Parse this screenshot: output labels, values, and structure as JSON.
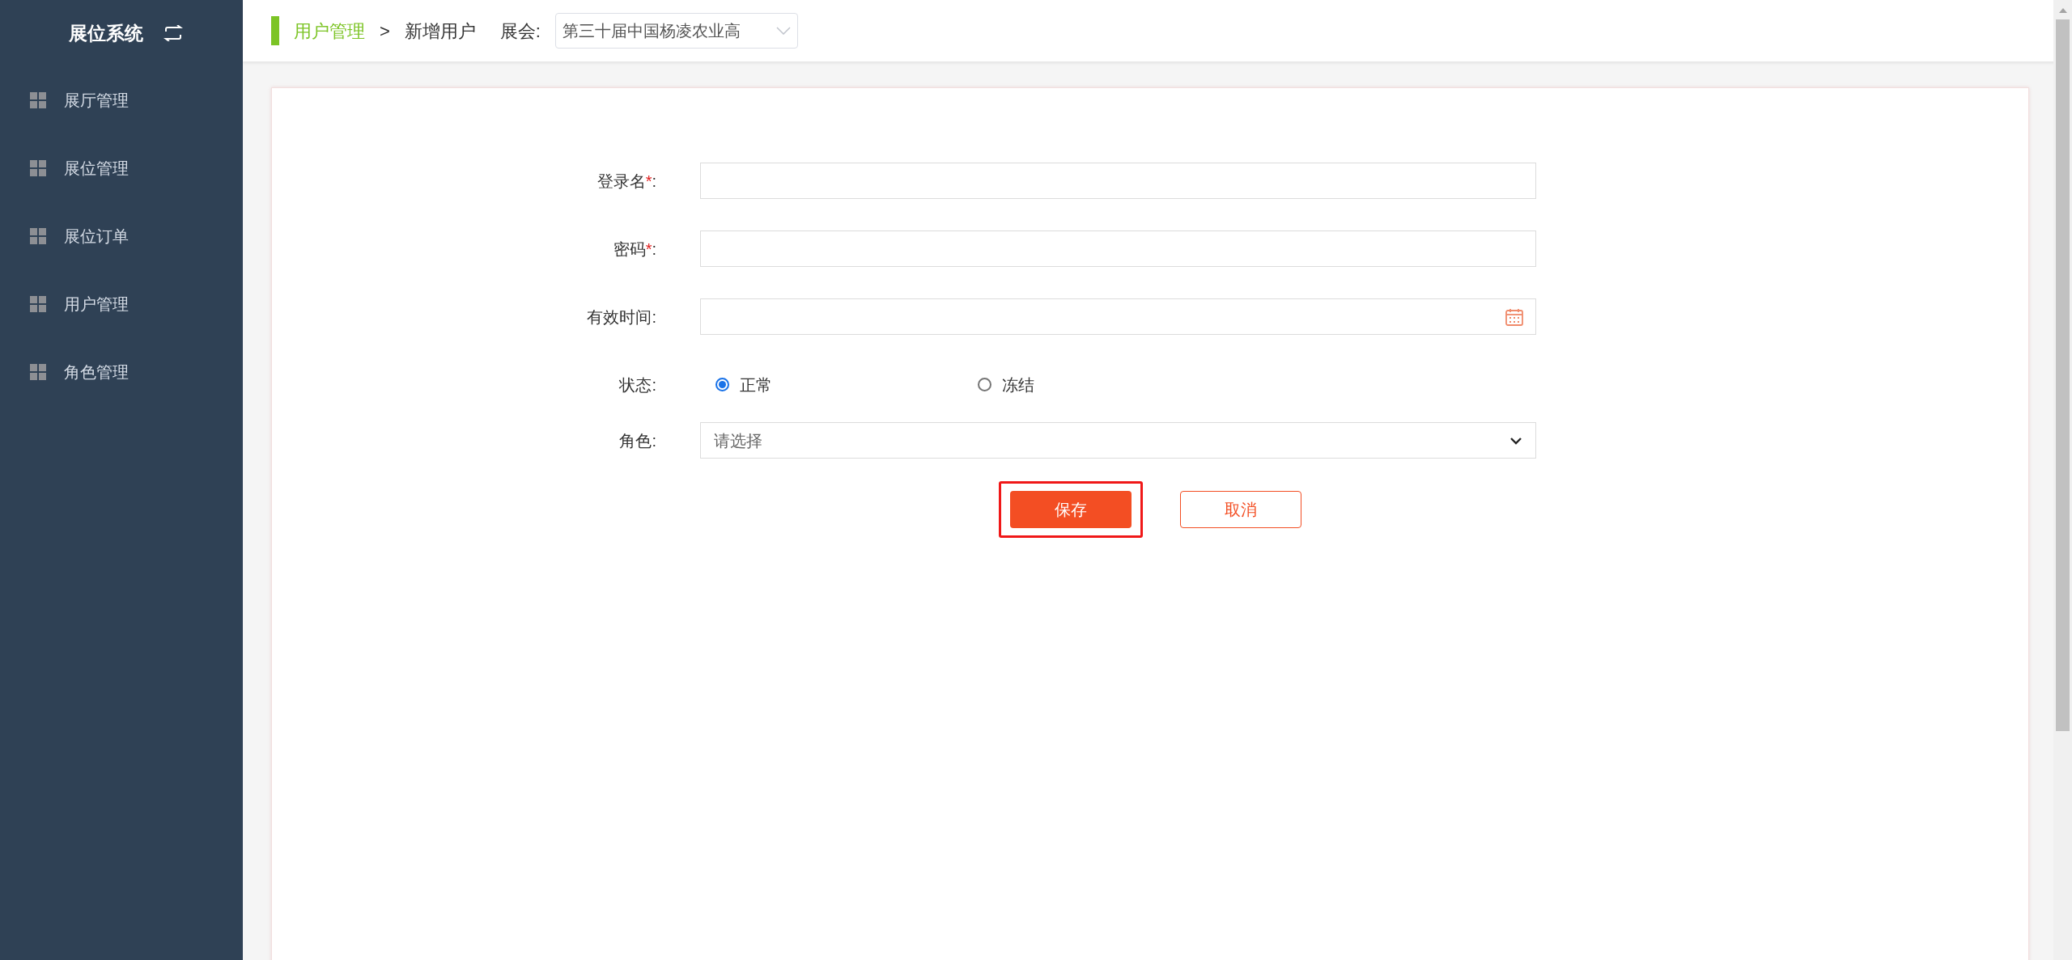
{
  "sidebar": {
    "title": "展位系统",
    "items": [
      {
        "label": "展厅管理"
      },
      {
        "label": "展位管理"
      },
      {
        "label": "展位订单"
      },
      {
        "label": "用户管理"
      },
      {
        "label": "角色管理"
      }
    ]
  },
  "header": {
    "breadcrumb": [
      "用户管理",
      "新增用户"
    ],
    "separator": ">",
    "exhibition_label": "展会:",
    "exhibition_value": "第三十届中国杨凌农业高"
  },
  "form": {
    "fields": [
      {
        "kind": "text",
        "label": "登录名",
        "mark": "*",
        "suffix": ":"
      },
      {
        "kind": "password",
        "label": "密码",
        "mark": "*",
        "suffix": ":"
      },
      {
        "kind": "date",
        "label": "有效时间",
        "suffix": ":"
      },
      {
        "kind": "radio",
        "label": "状态",
        "suffix": ":",
        "options": [
          {
            "label": "正常",
            "selected": true
          },
          {
            "label": "冻结",
            "selected": false
          }
        ]
      },
      {
        "kind": "select",
        "label": "角色",
        "suffix": ":",
        "placeholder": "请选择"
      }
    ],
    "buttons": [
      {
        "label": "保存",
        "kind": "primary",
        "highlighted": true
      },
      {
        "label": "取消",
        "kind": "outline",
        "highlighted": false
      }
    ]
  }
}
